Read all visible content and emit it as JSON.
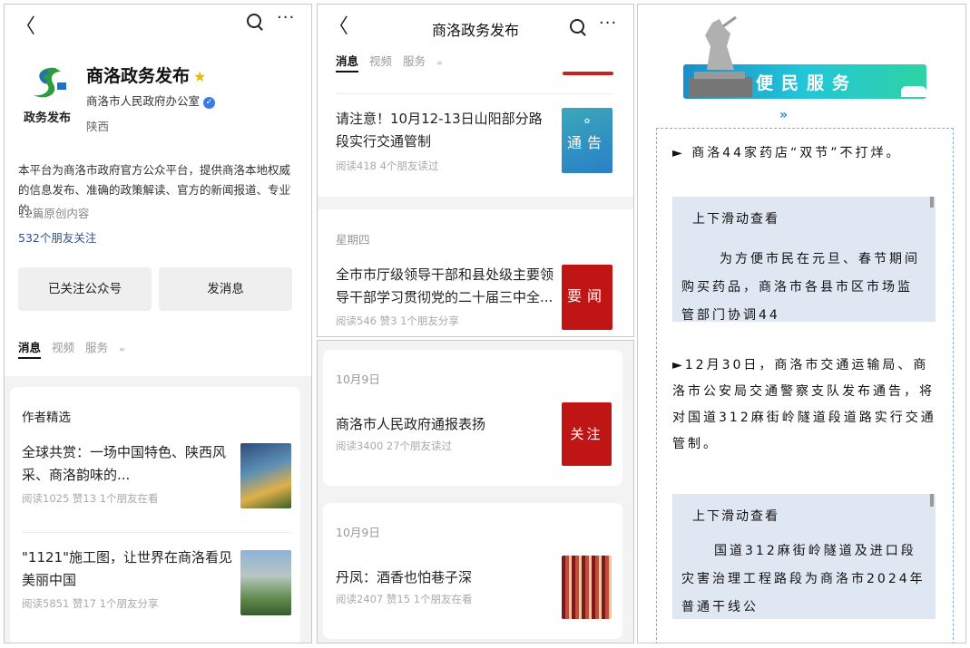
{
  "panel1": {
    "back_glyph": "〈",
    "more_glyph": "···",
    "account_name": "商洛政务发布",
    "star_glyph": "★",
    "account_org": "商洛市人民政府办公室",
    "verified_glyph": "✓",
    "region": "陕西",
    "logo_text": "政务发布",
    "description": "本平台为商洛市政府官方公众平台，提供商洛本地权威的信息发布、准确的政策解读、官方的新闻报道、专业的...",
    "desc_arrow": "›",
    "original_count": "12篇原创内容",
    "friends_following": "532个朋友关注",
    "followed_button": "已关注公众号",
    "message_button": "发消息",
    "tabs": [
      "消息",
      "视频",
      "服务"
    ],
    "service_mark": "≡",
    "picks_header": "作者精选",
    "articles": [
      {
        "title": "全球共赏：一场中国特色、陕西风采、商洛韵味的...",
        "meta": "阅读1025  赞13  1个朋友在看"
      },
      {
        "title": "\"1121\"施工图，让世界在商洛看见美丽中国",
        "meta": "阅读5851  赞17  1个朋友分享"
      }
    ]
  },
  "panel2": {
    "back_glyph": "〈",
    "title": "商洛政务发布",
    "more_glyph": "···",
    "tabs": [
      "消息",
      "视频",
      "服务"
    ],
    "service_mark": "≡",
    "article1": {
      "title": "请注意！10月12-13日山阳部分路段实行交通管制",
      "meta": "阅读418  4个朋友读过",
      "thumb_text": "通告"
    },
    "day_label": "星期四",
    "article2": {
      "title": "全市市厅级领导干部和县处级主要领导干部学习贯彻党的二十届三中全...",
      "meta": "阅读546  赞3  1个朋友分享",
      "thumb_text": "要闻"
    }
  },
  "panel3": {
    "items": [
      {
        "date": "10月9日",
        "title": "商洛市人民政府通报表扬",
        "meta": "阅读3400  27个朋友读过",
        "thumb_text": "关注"
      },
      {
        "date": "10月9日",
        "title": "丹凤：酒香也怕巷子深",
        "meta": "阅读2407  赞15  1个朋友在看"
      }
    ]
  },
  "panel4": {
    "banner_text": "便民服务",
    "chevron_glyph": "»",
    "item1": "► 商洛44家药店“双节”不打烊。",
    "scroll1_title": "上下滑动查看",
    "scroll1_body": "为方便市民在元旦、春节期间购买药品，商洛市各县市区市场监管部门协调44",
    "item2": "►12月30日，商洛市交通运输局、商洛市公安局交通警察支队发布通告，将对国道312麻街岭隧道段道路实行交通管制。",
    "scroll2_title": "上下滑动查看",
    "scroll2_body": "国道312麻街岭隧道及进口段灾害治理工程路段为商洛市2024年普通干线公"
  },
  "colors": {
    "accent_red": "#c8221c",
    "link_blue": "#2a5592",
    "banner_teal": "#22c6d9",
    "dash_blue": "#7fb2d8"
  }
}
